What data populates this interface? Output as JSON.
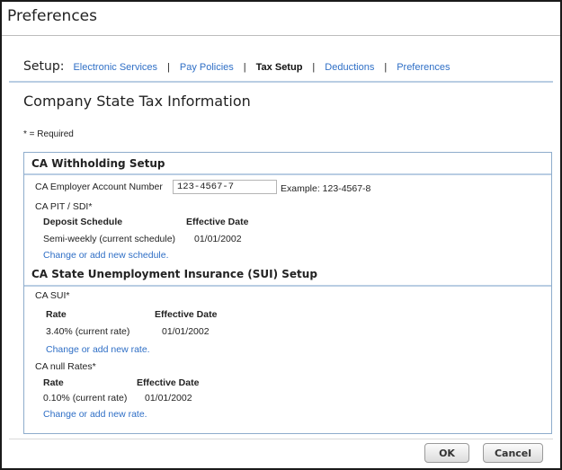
{
  "window": {
    "title": "Preferences"
  },
  "setup": {
    "label": "Setup:",
    "links": [
      "Electronic Services",
      "Pay Policies",
      "Tax Setup",
      "Deductions",
      "Preferences"
    ],
    "separator": "|"
  },
  "page": {
    "title": "Company State Tax Information",
    "required_note": "* = Required"
  },
  "withholding": {
    "heading": "CA Withholding Setup",
    "account_label": "CA Employer Account Number",
    "account_value": "123-4567-7",
    "example": "Example: 123-4567-8",
    "pit_label": "CA PIT / SDI*",
    "col_deposit": "Deposit Schedule",
    "col_effective": "Effective Date",
    "schedule": "Semi-weekly (current schedule)",
    "schedule_date": "01/01/2002",
    "change_link": "Change or add new schedule."
  },
  "sui": {
    "heading": "CA State Unemployment Insurance (SUI) Setup",
    "sui_label": "CA SUI*",
    "col_rate": "Rate",
    "col_effective": "Effective Date",
    "rate": "3.40% (current rate)",
    "rate_date": "01/01/2002",
    "change_link": "Change or add new rate.",
    "null_label": "CA null Rates*",
    "null_col_rate": "Rate",
    "null_col_effective": "Effective Date",
    "null_rate": "0.10% (current rate)",
    "null_date": "01/01/2002",
    "null_change_link": "Change or add new rate."
  },
  "buttons": {
    "ok": "OK",
    "cancel": "Cancel"
  },
  "colors": {
    "link": "#2f6fc6",
    "rule": "#b9cde3",
    "panel_border": "#8eaccc"
  }
}
